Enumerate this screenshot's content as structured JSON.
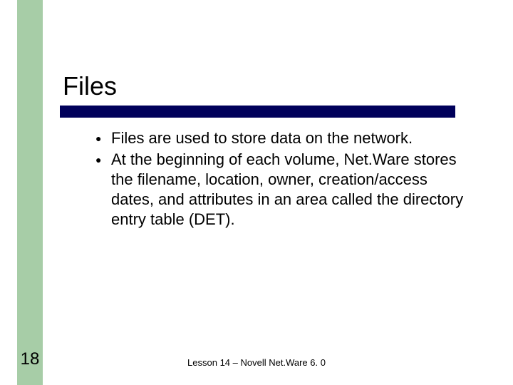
{
  "title": "Files",
  "bullets": [
    "Files are used to store data on the network.",
    "At the beginning of each volume, Net.Ware stores the filename, location, owner, creation/access dates, and attributes in an area called the directory entry table (DET)."
  ],
  "page_number": "18",
  "footer": "Lesson 14 – Novell Net.Ware 6. 0"
}
